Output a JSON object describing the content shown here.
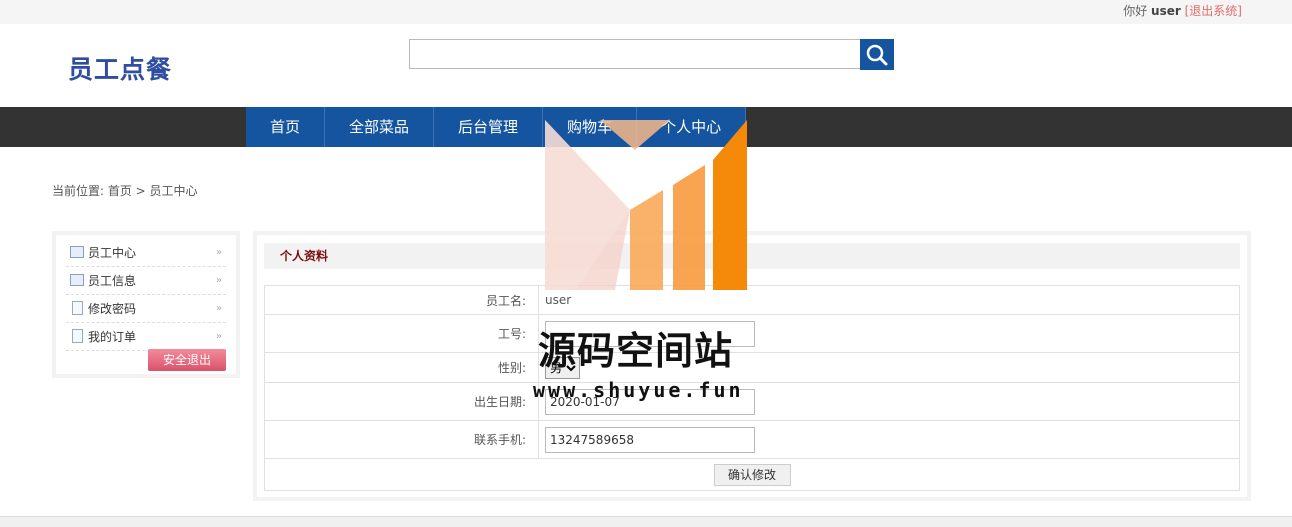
{
  "topbar": {
    "greeting": "你好",
    "username": "user",
    "logout": "[退出系统]"
  },
  "header": {
    "logo": "员工点餐",
    "search": {
      "value": "",
      "placeholder": ""
    }
  },
  "nav": [
    "首页",
    "全部菜品",
    "后台管理",
    "购物车",
    "个人中心"
  ],
  "breadcrumb": "当前位置: 首页 > 员工中心",
  "sidebar": {
    "items": [
      {
        "label": "员工中心",
        "icon": "id-card-icon"
      },
      {
        "label": "员工信息",
        "icon": "id-card-icon"
      },
      {
        "label": "修改密码",
        "icon": "document-icon"
      },
      {
        "label": "我的订单",
        "icon": "document-icon"
      }
    ],
    "exit": "安全退出"
  },
  "panel": {
    "title": "个人资料",
    "fields": {
      "name_label": "员工名:",
      "name_value": "user",
      "id_label": "工号:",
      "id_value": "",
      "gender_label": "性别:",
      "gender_value": "男",
      "dob_label": "出生日期:",
      "dob_value": "2020-01-07",
      "phone_label": "联系手机:",
      "phone_value": "13247589658"
    },
    "submit": "确认修改"
  },
  "watermark": {
    "title": "源码空间站",
    "url": "www.shuyue.fun"
  },
  "colors": {
    "nav_blue": "#15559f",
    "logo_blue": "#2f4ea0",
    "wm_orange": "#f5890a"
  }
}
